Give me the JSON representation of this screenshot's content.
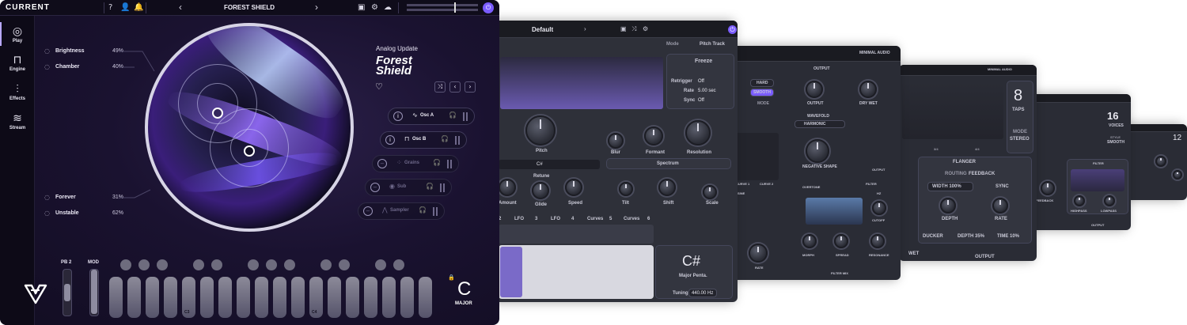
{
  "main": {
    "brand": "CURRENT",
    "preset_name": "FOREST SHIELD",
    "toolbar": {
      "help": "?",
      "prev": "‹",
      "next": "›"
    },
    "nav": [
      {
        "label": "Play",
        "icon": "play-disc-icon",
        "glyph": "◎"
      },
      {
        "label": "Engine",
        "icon": "engine-wave-icon",
        "glyph": "⊓"
      },
      {
        "label": "Effects",
        "icon": "effects-sliders-icon",
        "glyph": "⫶"
      },
      {
        "label": "Stream",
        "icon": "stream-waves-icon",
        "glyph": "≋"
      }
    ],
    "macros": [
      {
        "name": "Brightness",
        "value": "49%"
      },
      {
        "name": "Chamber",
        "value": "40%"
      },
      {
        "name": "Forever",
        "value": "31%"
      },
      {
        "name": "Unstable",
        "value": "62%"
      }
    ],
    "pack": "Analog Update",
    "title_line1": "Forest",
    "title_line2": "Shield",
    "layers": [
      {
        "name": "Osc A",
        "glyph": "∿",
        "state": "on"
      },
      {
        "name": "Osc B",
        "glyph": "⊓",
        "state": "on"
      },
      {
        "name": "Grains",
        "glyph": "⁘",
        "state": "off"
      },
      {
        "name": "Sub",
        "glyph": "◉",
        "state": "off"
      },
      {
        "name": "Sampler",
        "glyph": "⋀",
        "state": "off"
      }
    ],
    "wheels": {
      "pb_label": "PB",
      "pb_range": "2",
      "mod_label": "MOD"
    },
    "octave_labels": {
      "c3": "C3",
      "c4": "C4"
    },
    "key_root": "C",
    "key_scale": "MAJOR"
  },
  "win2": {
    "preset": "Default",
    "mode_label": "Mode",
    "mode_value": "Pitch Track",
    "freeze_label": "Freeze",
    "retrigger_label": "Retrigger",
    "retrigger_value": "Off",
    "rate_label": "Rate",
    "rate_value": "5.00 sec",
    "sync_label": "Sync",
    "sync_value": "Off",
    "pitch": "Pitch",
    "blur": "Blur",
    "formant": "Formant",
    "resolution": "Resolution",
    "note": "C#",
    "retune": "Retune",
    "spectrum": "Spectrum",
    "amount": "Amount",
    "glide": "Glide",
    "speed": "Speed",
    "tilt": "Tilt",
    "shift": "Shift",
    "scale": "Scale",
    "mod_tabs": [
      "2",
      "LFO",
      "3",
      "LFO",
      "4",
      "Curves",
      "5",
      "Curves",
      "6"
    ],
    "key_note": "C#",
    "key_scale": "Major Penta.",
    "tuning_label": "Tuning",
    "tuning_value": "440.00 Hz"
  },
  "win3": {
    "output_header": "OUTPUT",
    "hard": "HARD",
    "smooth": "SMOOTH",
    "mode": "MODE",
    "output": "OUTPUT",
    "dry_wet": "DRY WET",
    "wavefold": "WAVEFOLD",
    "harmonic": "HARMONIC",
    "negative_shape": "NEGATIVE SHAPE",
    "curve1": "CURVE 1",
    "curve2": "CURVE 2",
    "filter": "FILTER",
    "sine": "SINE",
    "overtone": "OVERTONE",
    "hz": "HZ",
    "cutoff": "CUTOFF",
    "morph": "MORPH",
    "spread": "SPREAD",
    "resonance": "RESONANCE",
    "rate": "RATE",
    "filter_mix": "FILTER MIX",
    "output2": "OUTPUT",
    "brand": "MINIMAL AUDIO"
  },
  "win4": {
    "taps_value": "8",
    "taps_label": "TAPS",
    "mode_label": "MODE",
    "mode_value": "STEREO",
    "ticks": [
      "3/4",
      "4/4"
    ],
    "flanger": "FLANGER",
    "routing": "ROUTING",
    "feedback": "FEEDBACK",
    "width": "WIDTH 100%",
    "sync": "SYNC",
    "depth": "DEPTH",
    "rate": "RATE",
    "ducker": "DUCKER",
    "depth_val": "DEPTH 35%",
    "time_val": "TIME 10%",
    "wet": "WET",
    "output": "OUTPUT",
    "brand": "MINIMAL AUDIO"
  },
  "win5": {
    "voices_value": "16",
    "voices_label": "VOICES",
    "style_label": "STYLE",
    "style_value": "SMOOTH",
    "filter": "FILTER",
    "feedback": "FEEDBACK",
    "highpass": "HIGHPASS",
    "lowpass": "LOWPASS",
    "output": "OUTPUT"
  },
  "win6": {
    "value": "12"
  },
  "colors": {
    "accent": "#7a5cff",
    "panel": "#33353f",
    "bg": "#120d22"
  }
}
